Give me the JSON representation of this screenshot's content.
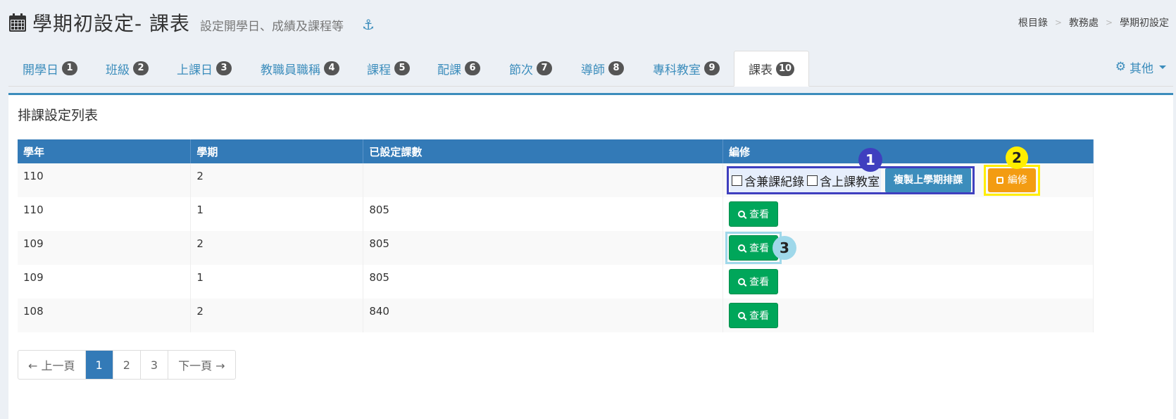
{
  "header": {
    "title": "學期初設定- 課表",
    "subtitle": "設定開學日、成績及課程等",
    "anchor_icon": "anchor-icon"
  },
  "breadcrumb": [
    "根目錄",
    "教務處",
    "學期初設定"
  ],
  "tabs": [
    {
      "label": "開學日",
      "badge": "1"
    },
    {
      "label": "班級",
      "badge": "2"
    },
    {
      "label": "上課日",
      "badge": "3"
    },
    {
      "label": "教職員職稱",
      "badge": "4"
    },
    {
      "label": "課程",
      "badge": "5"
    },
    {
      "label": "配課",
      "badge": "6"
    },
    {
      "label": "節次",
      "badge": "7"
    },
    {
      "label": "導師",
      "badge": "8"
    },
    {
      "label": "專科教室",
      "badge": "9"
    },
    {
      "label": "課表",
      "badge": "10"
    }
  ],
  "other_menu": "其他",
  "box_title": "排課設定列表",
  "table": {
    "headers": [
      "學年",
      "學期",
      "已設定課數",
      "編修"
    ],
    "rows": [
      {
        "year": "110",
        "term": "2",
        "count": ""
      },
      {
        "year": "110",
        "term": "1",
        "count": "805"
      },
      {
        "year": "109",
        "term": "2",
        "count": "805"
      },
      {
        "year": "109",
        "term": "1",
        "count": "805"
      },
      {
        "year": "108",
        "term": "2",
        "count": "840"
      }
    ]
  },
  "ops": {
    "chk_cross": "含兼課紀錄",
    "chk_room": "含上課教室",
    "copy_button": "複製上學期排課",
    "edit_button": "編修",
    "view_button": "查看"
  },
  "markers": [
    "1",
    "2",
    "3"
  ],
  "pagination": {
    "prev": "← 上一頁",
    "pages": [
      "1",
      "2",
      "3"
    ],
    "next": "下一頁 →"
  },
  "colors": {
    "primary": "#3c8dbc",
    "success": "#00a65a",
    "warning": "#f39c12",
    "header_blue": "#337ab7"
  }
}
